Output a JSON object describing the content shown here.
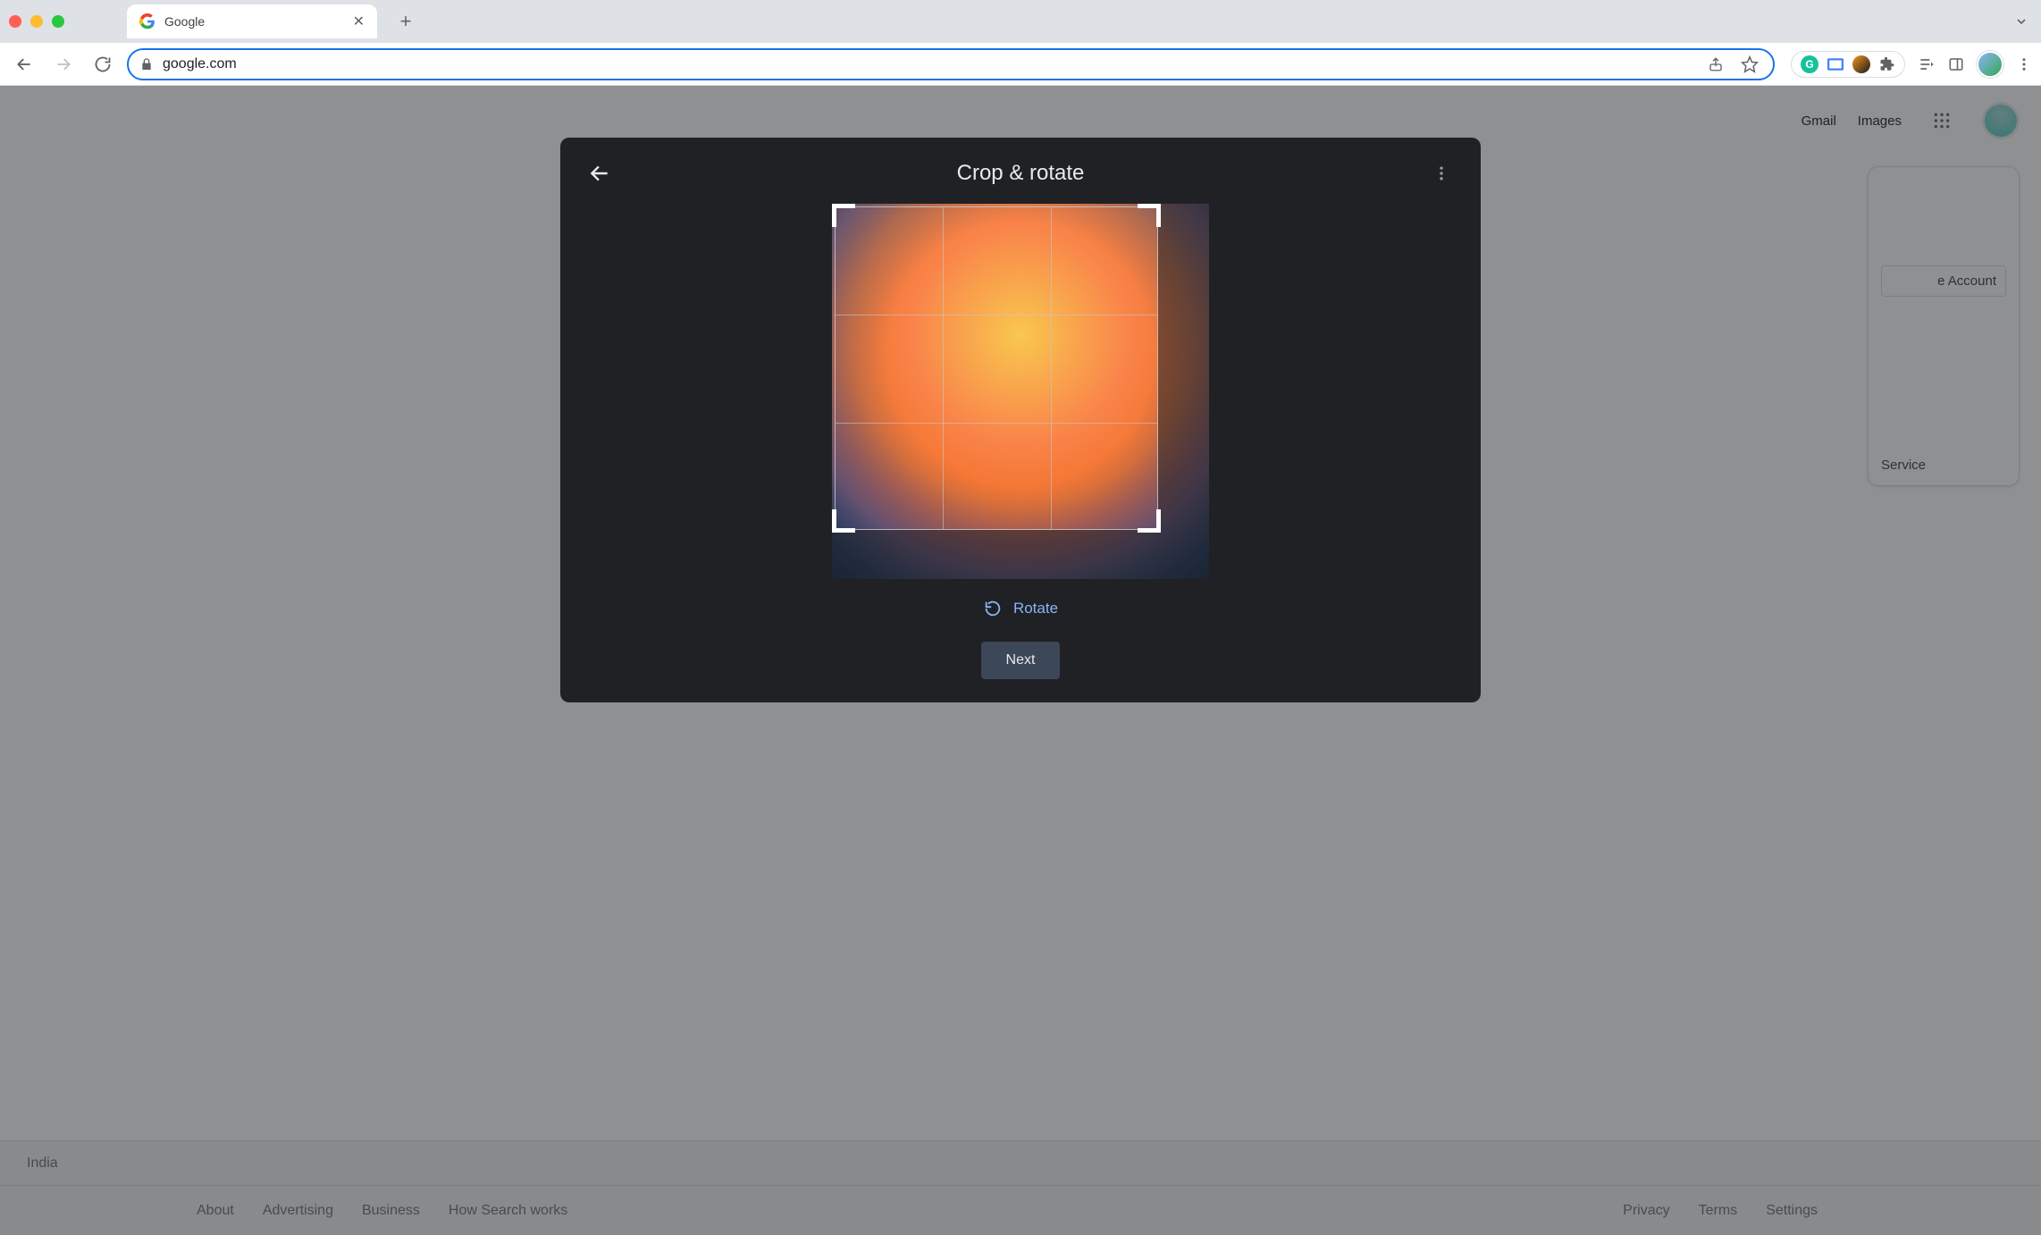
{
  "browser": {
    "tab_title": "Google",
    "url": "google.com"
  },
  "page": {
    "header": {
      "gmail": "Gmail",
      "images": "Images"
    },
    "card": {
      "manage_account": "e Account",
      "service": "Service"
    },
    "footer": {
      "country": "India",
      "left": [
        "About",
        "Advertising",
        "Business",
        "How Search works"
      ],
      "right": [
        "Privacy",
        "Terms",
        "Settings"
      ]
    }
  },
  "modal": {
    "title": "Crop & rotate",
    "rotate_label": "Rotate",
    "next_label": "Next"
  }
}
